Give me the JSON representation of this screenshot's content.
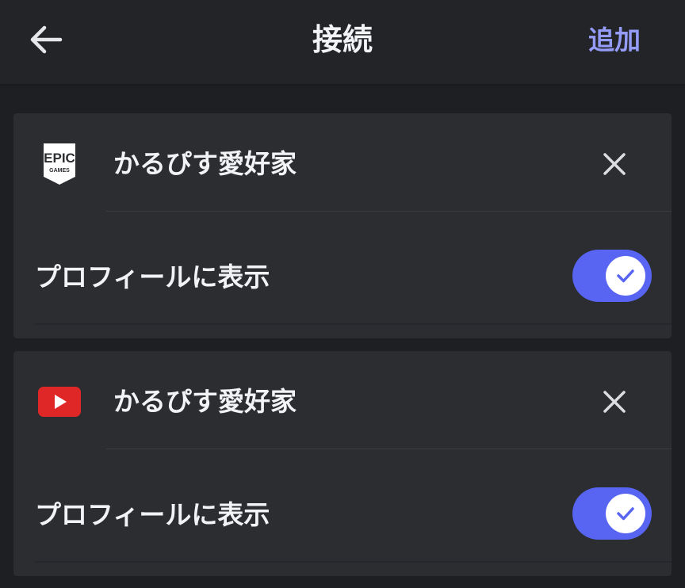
{
  "header": {
    "title": "接続",
    "add_label": "追加",
    "back_icon": "arrow-left-icon"
  },
  "connections": [
    {
      "service": "Epic Games",
      "service_icon": "epic-games-logo",
      "logo_text_top": "EPIC",
      "logo_text_bottom": "GAMES",
      "account_name": "かるぴす愛好家",
      "remove_icon": "close-icon",
      "show_on_profile_label": "プロフィールに表示",
      "show_on_profile": true
    },
    {
      "service": "YouTube",
      "service_icon": "youtube-icon",
      "account_name": "かるぴす愛好家",
      "remove_icon": "close-icon",
      "show_on_profile_label": "プロフィールに表示",
      "show_on_profile": true
    }
  ],
  "colors": {
    "background": "#1e1f23",
    "header": "#232428",
    "card": "#2b2d31",
    "accent": "#949cf7",
    "toggle_on": "#5865f2",
    "youtube_red": "#e02727"
  }
}
